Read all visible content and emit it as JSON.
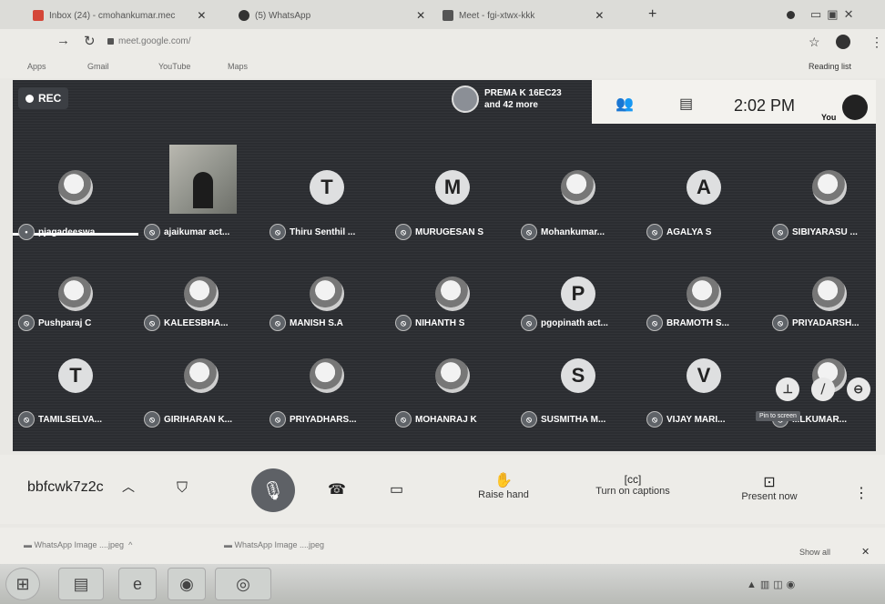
{
  "browser": {
    "tabs": [
      {
        "title": "Inbox (24) - cmohankumar.mec",
        "icon": "gmail-icon"
      },
      {
        "title": "(5) WhatsApp",
        "icon": "whatsapp-icon"
      },
      {
        "title": "Meet - fgi-xtwx-kkk",
        "icon": "meet-icon"
      }
    ],
    "new_tab": "+",
    "url": "meet.google.com/",
    "bookmarks": [
      "Apps",
      "Gmail",
      "YouTube",
      "Maps"
    ],
    "reading_list": "Reading list"
  },
  "meet": {
    "rec_label": "REC",
    "presenter_line1": "PREMA K 16EC23",
    "presenter_line2": "and 42 more",
    "time": "2:02 PM",
    "you_label": "You",
    "participants": [
      {
        "name": "pjagadeeswa...",
        "avatar": "photo"
      },
      {
        "name": "ajaikumar act...",
        "avatar": "photo"
      },
      {
        "name": "Thiru Senthil ...",
        "avatar": "T"
      },
      {
        "name": "MURUGESAN S",
        "avatar": "M"
      },
      {
        "name": "Mohankumar...",
        "avatar": "photo"
      },
      {
        "name": "AGALYA S",
        "avatar": "A"
      },
      {
        "name": "SIBIYARASU ...",
        "avatar": "photo"
      },
      {
        "name": "Pushparaj C",
        "avatar": "photo"
      },
      {
        "name": "KALEESBHA...",
        "avatar": "photo"
      },
      {
        "name": "MANISH S.A",
        "avatar": "photo"
      },
      {
        "name": "NIHANTH S",
        "avatar": "photo"
      },
      {
        "name": "pgopinath act...",
        "avatar": "P"
      },
      {
        "name": "BRAMOTH S...",
        "avatar": "photo"
      },
      {
        "name": "PRIYADARSH...",
        "avatar": "photo"
      },
      {
        "name": "TAMILSELVA...",
        "avatar": "T"
      },
      {
        "name": "GIRIHARAN K...",
        "avatar": "photo"
      },
      {
        "name": "PRIYADHARS...",
        "avatar": "photo"
      },
      {
        "name": "MOHANRAJ K",
        "avatar": "photo"
      },
      {
        "name": "SUSMITHA M...",
        "avatar": "S"
      },
      {
        "name": "VIJAY MARI...",
        "avatar": "V"
      },
      {
        "name": "...LKUMAR...",
        "avatar": "photo"
      }
    ],
    "pin_tooltip": "Pin to screen"
  },
  "controls": {
    "meeting_code": "bbfcwk7z2c",
    "raise_hand": "Raise hand",
    "captions": "Turn on captions",
    "present": "Present now"
  },
  "downloads": {
    "items": [
      "WhatsApp Image ....jpeg",
      "WhatsApp Image ....jpeg"
    ],
    "show_all": "Show all"
  }
}
